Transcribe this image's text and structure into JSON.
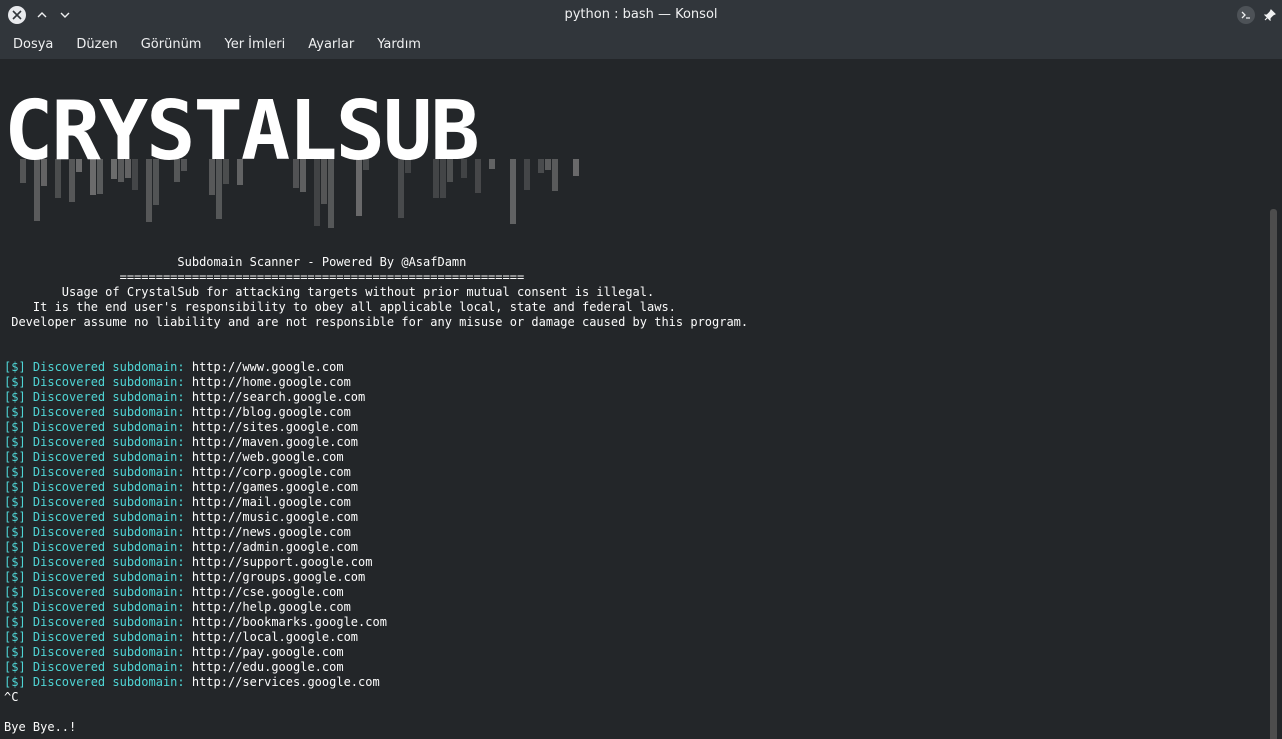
{
  "window": {
    "title": "python : bash — Konsol"
  },
  "menu": [
    "Dosya",
    "Düzen",
    "Görünüm",
    "Yer İmleri",
    "Ayarlar",
    "Yardım"
  ],
  "banner": {
    "text": "CRYSTALSUB",
    "color": "#ffffff"
  },
  "terminal": {
    "header_lines": [
      "                        Subdomain Scanner - Powered By @AsafDamn",
      "                ========================================================",
      "        Usage of CrystalSub for attacking targets without prior mutual consent is illegal.",
      "    It is the end user's responsibility to obey all applicable local, state and federal laws.",
      " Developer assume no liability and are not responsible for any misuse or damage caused by this program."
    ],
    "prefix": "[$] Discovered subdomain:",
    "subdomains": [
      "http://www.google.com",
      "http://home.google.com",
      "http://search.google.com",
      "http://blog.google.com",
      "http://sites.google.com",
      "http://maven.google.com",
      "http://web.google.com",
      "http://corp.google.com",
      "http://games.google.com",
      "http://mail.google.com",
      "http://music.google.com",
      "http://news.google.com",
      "http://admin.google.com",
      "http://support.google.com",
      "http://groups.google.com",
      "http://cse.google.com",
      "http://help.google.com",
      "http://bookmarks.google.com",
      "http://local.google.com",
      "http://pay.google.com",
      "http://edu.google.com",
      "http://services.google.com"
    ],
    "interrupt": "^C",
    "footer": "Bye Bye..!"
  },
  "colors": {
    "background": "#232629",
    "chrome": "#31363b",
    "prefix": "#4fd5d5",
    "text": "#fcfcfc"
  }
}
